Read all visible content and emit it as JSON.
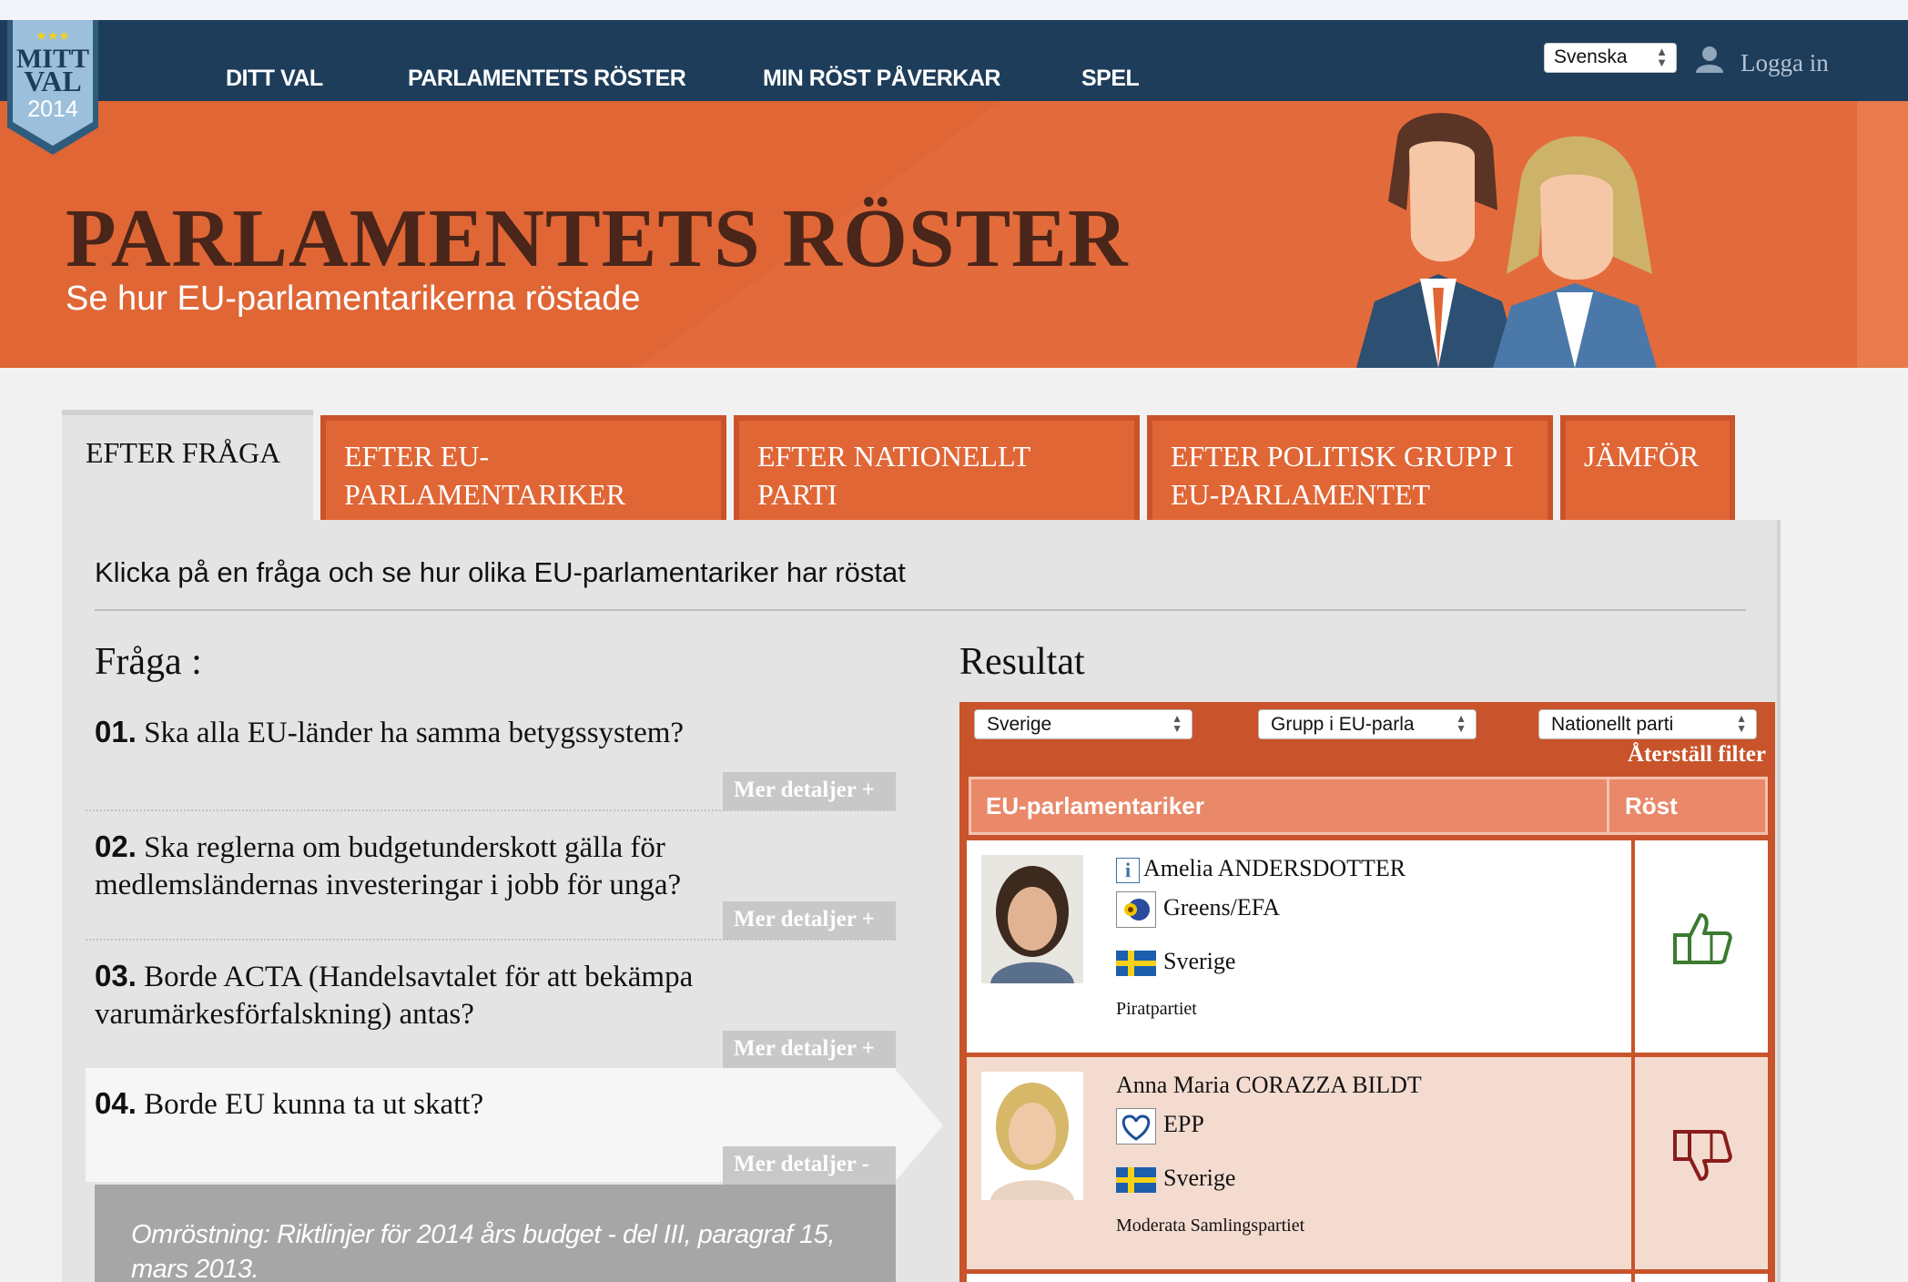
{
  "logo": {
    "line1": "MITT",
    "line2": "VAL",
    "year": "2014"
  },
  "nav": {
    "items": [
      {
        "label": "DITT VAL"
      },
      {
        "label": "PARLAMENTETS RÖSTER"
      },
      {
        "label": "MIN RÖST PÅVERKAR"
      },
      {
        "label": "SPEL"
      }
    ],
    "language": "Svenska",
    "login": "Logga in"
  },
  "banner": {
    "title": "PARLAMENTETS RÖSTER",
    "subtitle": "Se hur EU-parlamentarikerna röstade"
  },
  "tabs": [
    {
      "label": "EFTER FRÅGA",
      "active": true
    },
    {
      "label": "EFTER EU-PARLAMENTARIKER",
      "active": false
    },
    {
      "label": "EFTER NATIONELLT PARTI",
      "active": false
    },
    {
      "label": "EFTER POLITISK GRUPP I EU-PARLAMENTET",
      "active": false
    },
    {
      "label": "JÄMFÖR",
      "active": false
    }
  ],
  "intro": "Klicka på en fråga och se hur olika EU-parlamentariker har röstat",
  "questions_heading": "Fråga :",
  "questions": [
    {
      "num": "01.",
      "text": "Ska alla EU-länder ha samma betygssystem?",
      "more": "Mer detaljer +"
    },
    {
      "num": "02.",
      "text": "Ska reglerna om budgetunderskott gälla för medlemsländernas investeringar i jobb för unga?",
      "more": "Mer detaljer +"
    },
    {
      "num": "03.",
      "text": "Borde ACTA (Handelsavtalet för att bekämpa varumärkesförfalskning) antas?",
      "more": "Mer detaljer +"
    },
    {
      "num": "04.",
      "text": "Borde EU kunna ta ut skatt?",
      "more": "Mer detaljer -"
    }
  ],
  "detail_text": "Omröstning: Riktlinjer för 2014 års budget - del III, paragraf 15, mars 2013.",
  "results": {
    "heading": "Resultat",
    "filters": {
      "country": "Sverige",
      "group": "Grupp i EU-parla",
      "party": "Nationellt parti"
    },
    "reset": "Återställ filter",
    "col_mep": "EU-parlamentariker",
    "col_vote": "Röst",
    "rows": [
      {
        "name": "Amelia ANDERSDOTTER",
        "group": "Greens/EFA",
        "country": "Sverige",
        "party": "Piratpartiet",
        "vote": "yes",
        "vote_icon": "thumbs-up-icon",
        "vote_color": "#3b7a2f",
        "row_bg": "#ffffff"
      },
      {
        "name": "Anna Maria CORAZZA BILDT",
        "group": "EPP",
        "country": "Sverige",
        "party": "Moderata Samlingspartiet",
        "vote": "no",
        "vote_icon": "thumbs-down-icon",
        "vote_color": "#8a1c1c",
        "row_bg": "#f4dbd0"
      }
    ]
  },
  "colors": {
    "navbar": "#1e3d5a",
    "accent": "#e06636",
    "accent_dark": "#c9532a",
    "title_brown": "#4a2519"
  }
}
